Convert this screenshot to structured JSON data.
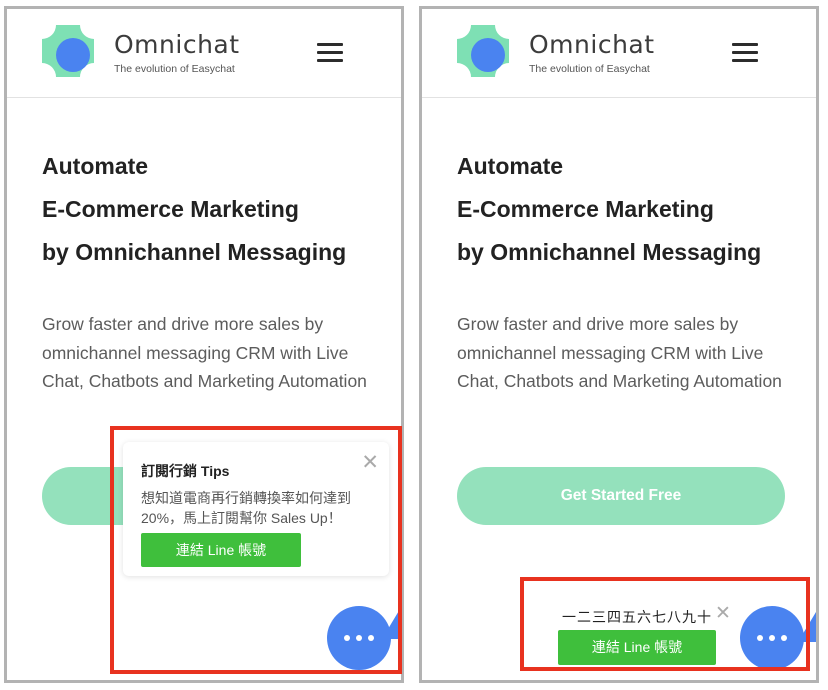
{
  "brand": {
    "name": "Omnichat",
    "tagline": "The evolution of Easychat"
  },
  "hero": {
    "title_lines": [
      "Automate",
      "E-Commerce Marketing",
      "by Omnichannel Messaging"
    ],
    "description": "Grow faster and drive more sales by omnichannel messaging CRM with Live Chat, Chatbots and Marketing Automation",
    "cta_label": "Get Started Free"
  },
  "left_popup": {
    "title": "訂閱行銷 Tips",
    "close_glyph": "✕",
    "body": "想知道電商再行銷轉換率如何達到 20%，馬上訂閱幫你 Sales Up！",
    "button_label": "連結 Line 帳號"
  },
  "right_popup": {
    "title": "一二三四五六七八九十",
    "close_glyph": "✕",
    "button_label": "連結 Line 帳號"
  },
  "icons": {
    "menu": "hamburger-menu-icon",
    "chat": "chat-dots-icon",
    "close": "close-icon"
  },
  "colors": {
    "cta": "#94e1bc",
    "line_green": "#3fbf3c",
    "chat_blue": "#4a83f0",
    "highlight": "#e8321f",
    "logo_green": "#7ee0b4",
    "logo_blue": "#4a83f0"
  }
}
